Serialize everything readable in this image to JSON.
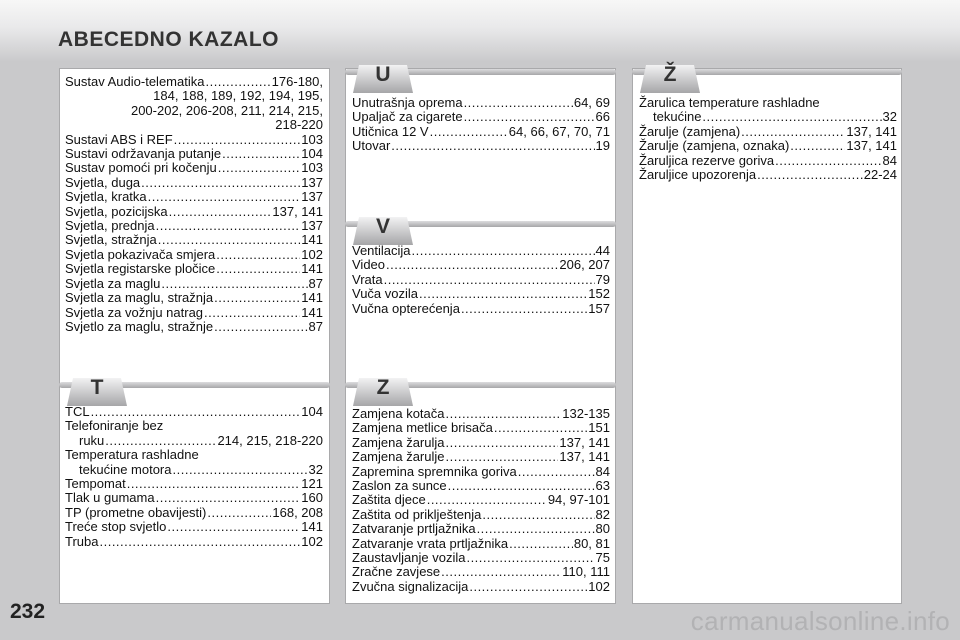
{
  "header": {
    "title": "ABECEDNO KAZALO",
    "page_number": "232"
  },
  "watermark": "carmanualsonline.info",
  "col1_top": [
    {
      "t": "Sustav Audio-telematika",
      "p": "176-180,"
    },
    {
      "c": "184, 188, 189, 192, 194, 195,"
    },
    {
      "c": "200-202, 206-208, 211, 214, 215,"
    },
    {
      "c": "218-220"
    },
    {
      "t": "Sustavi ABS i REF",
      "p": "103"
    },
    {
      "t": "Sustavi održavanja putanje",
      "p": "104"
    },
    {
      "t": "Sustav pomoći pri kočenju",
      "p": "103"
    },
    {
      "t": "Svjetla, duga",
      "p": "137"
    },
    {
      "t": "Svjetla, kratka",
      "p": "137"
    },
    {
      "t": "Svjetla, pozicijska",
      "p": "137, 141"
    },
    {
      "t": "Svjetla, prednja",
      "p": "137"
    },
    {
      "t": "Svjetla, stražnja",
      "p": "141"
    },
    {
      "t": "Svjetla pokazivača smjera",
      "p": "102"
    },
    {
      "t": "Svjetla registarske pločice",
      "p": "141"
    },
    {
      "t": "Svjetla za maglu",
      "p": "87"
    },
    {
      "t": "Svjetla za maglu, stražnja",
      "p": "141"
    },
    {
      "t": "Svjetla za vožnju natrag",
      "p": "141"
    },
    {
      "t": "Svjetlo za maglu, stražnje",
      "p": "87"
    }
  ],
  "section_T": {
    "letter": "T",
    "entries": [
      {
        "t": "TCL",
        "p": "104"
      },
      {
        "plain": "Telefoniranje bez"
      },
      {
        "t": "ruku",
        "p": "214, 215, 218-220",
        "indent": true
      },
      {
        "plain": "Temperatura rashladne"
      },
      {
        "t": "tekućine motora",
        "p": "32",
        "indent": true
      },
      {
        "t": "Tempomat",
        "p": "121"
      },
      {
        "t": "Tlak u gumama",
        "p": "160"
      },
      {
        "t": "TP (prometne obavijesti)",
        "p": "168, 208"
      },
      {
        "t": "Treće stop svjetlo",
        "p": "141"
      },
      {
        "t": "Truba",
        "p": "102"
      }
    ]
  },
  "section_U": {
    "letter": "U",
    "entries": [
      {
        "t": "Unutrašnja oprema",
        "p": "64, 69"
      },
      {
        "t": "Upaljač za cigarete",
        "p": "66"
      },
      {
        "t": "Utičnica 12 V",
        "p": "64, 66, 67, 70, 71"
      },
      {
        "t": "Utovar",
        "p": "19"
      }
    ]
  },
  "section_V": {
    "letter": "V",
    "entries": [
      {
        "t": "Ventilacija",
        "p": "44"
      },
      {
        "t": "Video",
        "p": "206, 207"
      },
      {
        "t": "Vrata",
        "p": "79"
      },
      {
        "t": "Vuča vozila",
        "p": "152"
      },
      {
        "t": "Vučna opterećenja",
        "p": "157"
      }
    ]
  },
  "section_Z": {
    "letter": "Z",
    "entries": [
      {
        "t": "Zamjena kotača",
        "p": "132-135"
      },
      {
        "t": "Zamjena metlice brisača",
        "p": "151"
      },
      {
        "t": "Zamjena žarulja",
        "p": "137, 141"
      },
      {
        "t": "Zamjena žarulje",
        "p": "137, 141"
      },
      {
        "t": "Zapremina spremnika goriva",
        "p": "84"
      },
      {
        "t": "Zaslon za sunce",
        "p": "63"
      },
      {
        "t": "Zaštita djece",
        "p": "94, 97-101"
      },
      {
        "t": "Zaštita od priklještenja",
        "p": "82"
      },
      {
        "t": "Zatvaranje prtljažnika",
        "p": "80"
      },
      {
        "t": "Zatvaranje vrata prtljažnika",
        "p": "80, 81"
      },
      {
        "t": "Zaustavljanje vozila",
        "p": "75"
      },
      {
        "t": "Zračne zavjese",
        "p": "110, 111"
      },
      {
        "t": "Zvučna signalizacija",
        "p": "102"
      }
    ]
  },
  "section_ZH": {
    "letter": "Ž",
    "entries": [
      {
        "plain": "Žarulica temperature rashladne"
      },
      {
        "t": "tekućine",
        "p": "32",
        "indent": true
      },
      {
        "t": "Žarulje (zamjena)",
        "p": "137, 141"
      },
      {
        "t": "Žarulje (zamjena, oznaka)",
        "p": "137, 141"
      },
      {
        "t": "Žaruljica rezerve goriva",
        "p": "84"
      },
      {
        "t": "Žaruljice upozorenja",
        "p": "22-24"
      }
    ]
  }
}
